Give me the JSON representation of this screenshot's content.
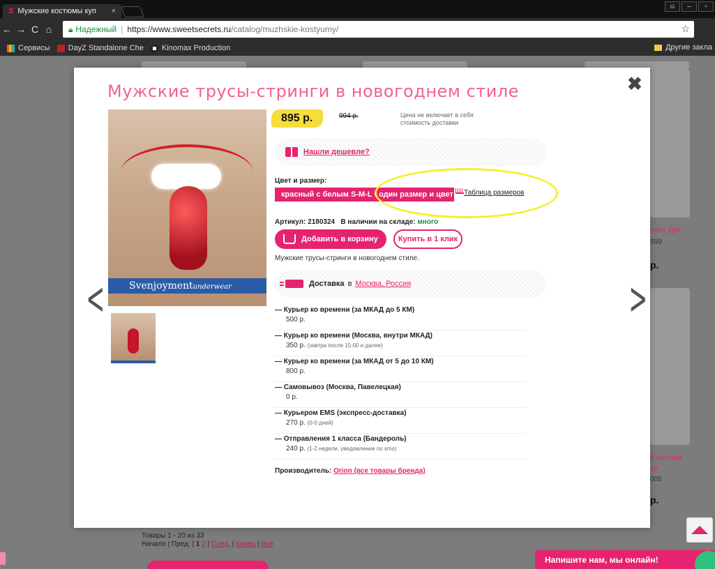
{
  "browser": {
    "tab_title": "Мужские костюмы куп",
    "tab_icon": "S",
    "tab_close": "×",
    "secure_label": "Надежный",
    "url_scheme_host": "https://www.sweetsecrets.ru",
    "url_path": "/catalog/muzhskie-kostyumy/",
    "bookmarks": [
      "Сервисы",
      "DayZ Standalone Che",
      "Kinomax Production"
    ],
    "other_bookmarks": "Другие закла"
  },
  "modal": {
    "title": "Мужские трусы-стринги в новогоднем стиле",
    "close": "✖",
    "photo_brand": "Svenjoyment",
    "photo_brand_sub": "underwear",
    "price": "895 р.",
    "old_price": "994 р.",
    "price_note": "Цена не включает в себя стоимость доставки",
    "cheaper_link": "Нашли дешевле?",
    "color_size_label": "Цвет и размер:",
    "variant": "красный с белым S-M-L - один размер и цвет",
    "size_table_link": "Таблица размеров",
    "sku_label": "Артикул: 2180324",
    "stock_label": "В наличии на складе:",
    "stock_value": "много",
    "add_to_cart": "Добавить в корзину",
    "buy_one_click": "Купить в 1 клик",
    "short_description": "Мужские трусы-стринги в новогоднем стиле.",
    "delivery_label": "Доставка",
    "delivery_in": "в",
    "delivery_city": "Москва, Россия",
    "delivery_options": [
      {
        "name": "— Курьер ко времени (за МКАД до 5 КМ)",
        "price": "500 р.",
        "note": ""
      },
      {
        "name": "— Курьер ко времени (Москва, внутри МКАД)",
        "price": "350 р.",
        "note": "(завтра после 15:00 и далее)"
      },
      {
        "name": "— Курьер ко времени (за МКАД от 5 до 10 КМ)",
        "price": "800 р.",
        "note": ""
      },
      {
        "name": "— Самовывоз (Москва, Павелецкая)",
        "price": "0 р.",
        "note": ""
      },
      {
        "name": "— Курьером EMS (экспресс-доставка)",
        "price": "270 р.",
        "note": "(0-0 дней)"
      },
      {
        "name": "— Отправления 1 класса (Бандероль)",
        "price": "240 р.",
        "note": "(1-2 недели, уведомление по sms)"
      }
    ],
    "maker_label": "Производитель:",
    "maker_link": "Orion (все товары бренда)"
  },
  "background": {
    "right_link_1": "лект Док",
    "right_text_1": "599",
    "right_bold_1": "р.",
    "right_link_2": "й костюм",
    "right_link_3": "ка",
    "right_text_2": "005",
    "right_bold_2": "р.",
    "items_count": "Товары 1 - 20 из 33",
    "pager_start": "Начало",
    "pager_prev": "Пред.",
    "pager_cur": "1",
    "pager_2": "2",
    "pager_next": "След.",
    "pager_end": "Конец",
    "pager_all": "Все",
    "chat": "Напишите нам, мы онлайн!"
  }
}
